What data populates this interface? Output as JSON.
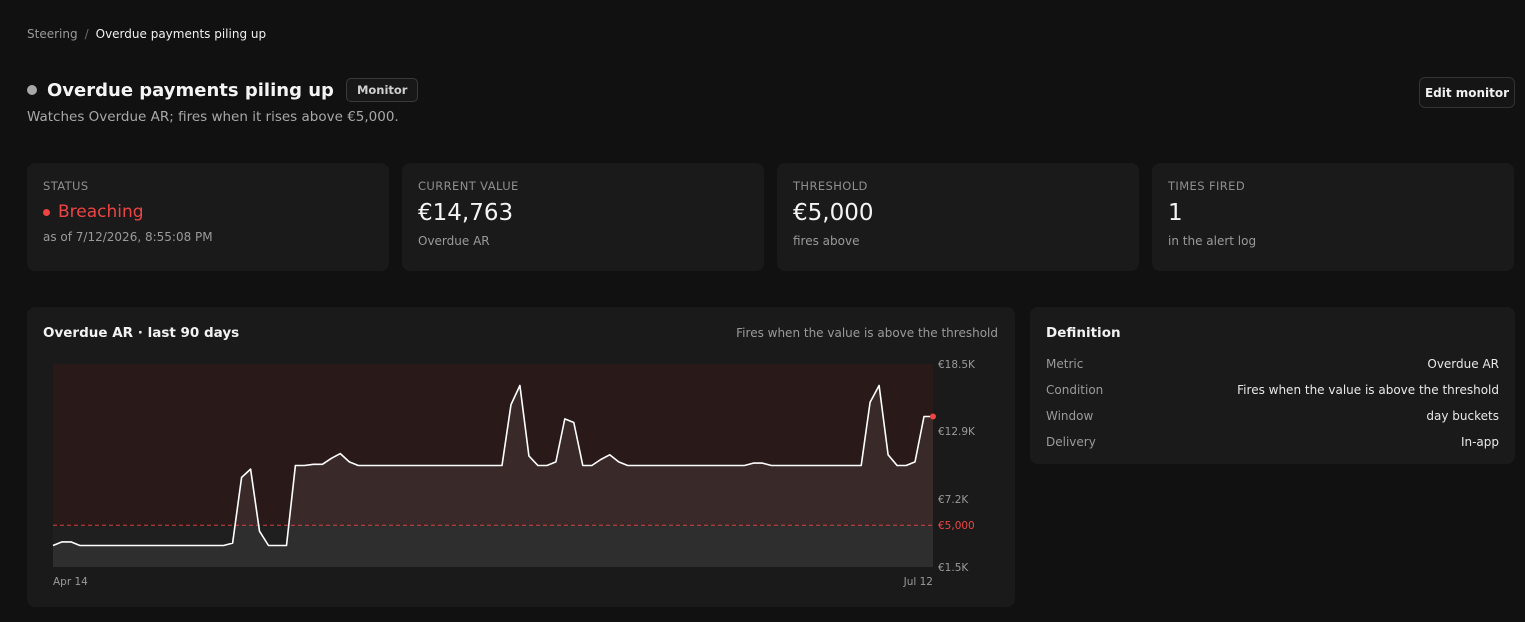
{
  "breadcrumb": {
    "parent": "Steering",
    "separator": "/",
    "current": "Overdue payments piling up"
  },
  "header": {
    "title": "Overdue payments piling up",
    "badge": "Monitor",
    "subtitle": "Watches Overdue AR; fires when it rises above €5,000.",
    "edit_label": "Edit monitor"
  },
  "kpis": {
    "status": {
      "label": "STATUS",
      "value": "Breaching",
      "sub": "as of 7/12/2026, 8:55:08 PM"
    },
    "current": {
      "label": "CURRENT VALUE",
      "value": "€14,763",
      "sub": "Overdue AR"
    },
    "threshold": {
      "label": "THRESHOLD",
      "value": "€5,000",
      "sub": "fires above"
    },
    "fired": {
      "label": "TIMES FIRED",
      "value": "1",
      "sub": "in the alert log"
    }
  },
  "chart": {
    "title": "Overdue AR · last 90 days",
    "note": "Fires when the value is above the threshold"
  },
  "chart_data": {
    "type": "area",
    "threshold": 5000,
    "threshold_label": "€5,000",
    "ylim": [
      1500,
      18500
    ],
    "yticks": [
      {
        "value": 18500,
        "label": "€18.5K"
      },
      {
        "value": 12900,
        "label": "€12.9K"
      },
      {
        "value": 7200,
        "label": "€7.2K"
      },
      {
        "value": 1500,
        "label": "€1.5K"
      }
    ],
    "x_labels": [
      "Apr 14",
      "Jul 12"
    ],
    "values": [
      3300,
      3600,
      3600,
      3300,
      3300,
      3300,
      3300,
      3300,
      3300,
      3300,
      3300,
      3300,
      3300,
      3300,
      3300,
      3300,
      3300,
      3300,
      3300,
      3300,
      3500,
      9000,
      9700,
      4500,
      3300,
      3300,
      3300,
      10000,
      10000,
      10100,
      10100,
      10600,
      11000,
      10300,
      10000,
      10000,
      10000,
      10000,
      10000,
      10000,
      10000,
      10000,
      10000,
      10000,
      10000,
      10000,
      10000,
      10000,
      10000,
      10000,
      10000,
      15100,
      16700,
      10800,
      10000,
      10000,
      10300,
      13900,
      13600,
      10000,
      10000,
      10500,
      10900,
      10300,
      10000,
      10000,
      10000,
      10000,
      10000,
      10000,
      10000,
      10000,
      10000,
      10000,
      10000,
      10000,
      10000,
      10000,
      10200,
      10200,
      10000,
      10000,
      10000,
      10000,
      10000,
      10000,
      10000,
      10000,
      10000,
      10000,
      10000,
      15300,
      16700,
      10900,
      10000,
      10000,
      10300,
      14100,
      14100
    ],
    "colors": {
      "line": "#ffffff",
      "breach": "#ef4444"
    }
  },
  "definition": {
    "title": "Definition",
    "rows": [
      {
        "key": "Metric",
        "value": "Overdue AR"
      },
      {
        "key": "Condition",
        "value": "Fires when the value is above the threshold"
      },
      {
        "key": "Window",
        "value": "day buckets"
      },
      {
        "key": "Delivery",
        "value": "In-app"
      }
    ]
  }
}
